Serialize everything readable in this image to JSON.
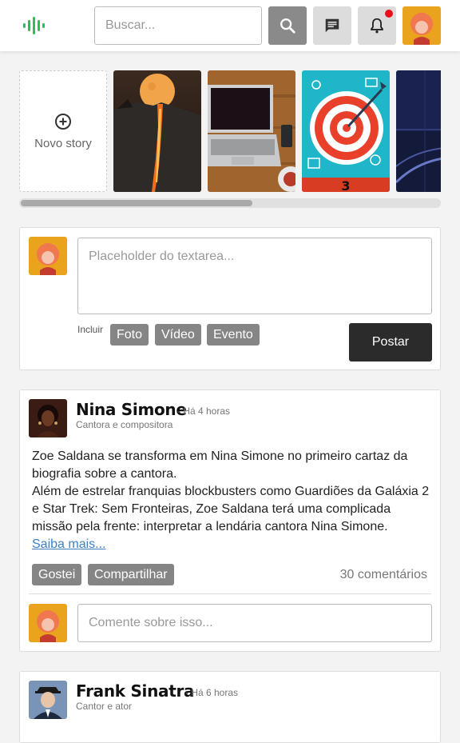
{
  "header": {
    "search_placeholder": "Buscar...",
    "icons": [
      "logo-soundwave-icon",
      "search-icon",
      "message-icon",
      "bell-icon"
    ],
    "has_notification": true
  },
  "stories": {
    "new_story_label": "Novo story",
    "items": [
      {
        "name": "story-moon-waterfall"
      },
      {
        "name": "story-laptop-desk"
      },
      {
        "name": "story-target",
        "label": "3"
      },
      {
        "name": "story-dark-abstract"
      }
    ]
  },
  "composer": {
    "placeholder": "Placeholder do textarea...",
    "include_label": "Incluir",
    "attachments": [
      "Foto",
      "Vídeo",
      "Evento"
    ],
    "post_label": "Postar"
  },
  "posts": [
    {
      "author": "Nina Simone",
      "time": "- Há 4 horas",
      "role": "Cantora e compositora",
      "body": "Zoe Saldana se transforma em Nina Simone no primeiro cartaz da biografia sobre a cantora.\nAlém de estrelar franquias blockbusters como Guardiões da Galáxia 2 e Star Trek: Sem Fronteiras, Zoe Saldana terá uma complicada missão pela frente: interpretar a lendária cantora Nina Simone.",
      "read_more": "Saiba mais...",
      "like_label": "Gostei",
      "share_label": "Compartilhar",
      "comments": "30 comentários",
      "comment_placeholder": "Comente sobre isso..."
    },
    {
      "author": "Frank Sinatra",
      "time": "- Há 6 horas",
      "role": "Cantor e ator"
    }
  ],
  "colors": {
    "accent": "#2ebd59",
    "notification": "#e8101a",
    "chip": "#858585",
    "post_button": "#2b2b2b",
    "link": "#3d80c4"
  }
}
